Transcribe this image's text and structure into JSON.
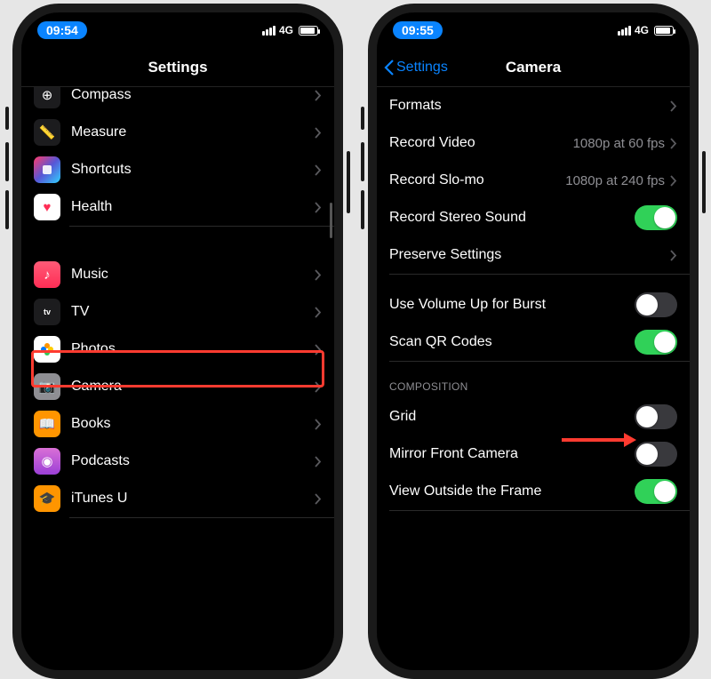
{
  "left": {
    "status": {
      "time": "09:54",
      "network": "4G"
    },
    "nav": {
      "title": "Settings"
    },
    "group1": [
      {
        "label": "Compass",
        "icon": "compass",
        "bg": "#1c1c1e"
      },
      {
        "label": "Measure",
        "icon": "measure",
        "bg": "#1c1c1e"
      },
      {
        "label": "Shortcuts",
        "icon": "shortcuts",
        "bg": "#1f2740"
      },
      {
        "label": "Health",
        "icon": "health",
        "bg": "#ffffff"
      }
    ],
    "group2": [
      {
        "label": "Music",
        "icon": "music",
        "bg": "#ff2d55"
      },
      {
        "label": "TV",
        "icon": "tv",
        "bg": "#1c1c1e"
      },
      {
        "label": "Photos",
        "icon": "photos",
        "bg": "#ffffff"
      },
      {
        "label": "Camera",
        "icon": "camera",
        "bg": "#8e8e93",
        "highlighted": true
      },
      {
        "label": "Books",
        "icon": "books",
        "bg": "#ff9500"
      },
      {
        "label": "Podcasts",
        "icon": "podcasts",
        "bg": "#9b59b6"
      },
      {
        "label": "iTunes U",
        "icon": "itunesu",
        "bg": "#ff9500"
      }
    ]
  },
  "right": {
    "status": {
      "time": "09:55",
      "network": "4G"
    },
    "nav": {
      "back": "Settings",
      "title": "Camera"
    },
    "group1": [
      {
        "label": "Formats",
        "type": "disclosure"
      },
      {
        "label": "Record Video",
        "value": "1080p at 60 fps",
        "type": "disclosure"
      },
      {
        "label": "Record Slo-mo",
        "value": "1080p at 240 fps",
        "type": "disclosure"
      },
      {
        "label": "Record Stereo Sound",
        "type": "toggle",
        "on": true
      },
      {
        "label": "Preserve Settings",
        "type": "disclosure"
      }
    ],
    "group2": [
      {
        "label": "Use Volume Up for Burst",
        "type": "toggle",
        "on": false
      },
      {
        "label": "Scan QR Codes",
        "type": "toggle",
        "on": true
      }
    ],
    "group3_header": "Composition",
    "group3": [
      {
        "label": "Grid",
        "type": "toggle",
        "on": false
      },
      {
        "label": "Mirror Front Camera",
        "type": "toggle",
        "on": false,
        "arrow": true
      },
      {
        "label": "View Outside the Frame",
        "type": "toggle",
        "on": true
      }
    ]
  }
}
